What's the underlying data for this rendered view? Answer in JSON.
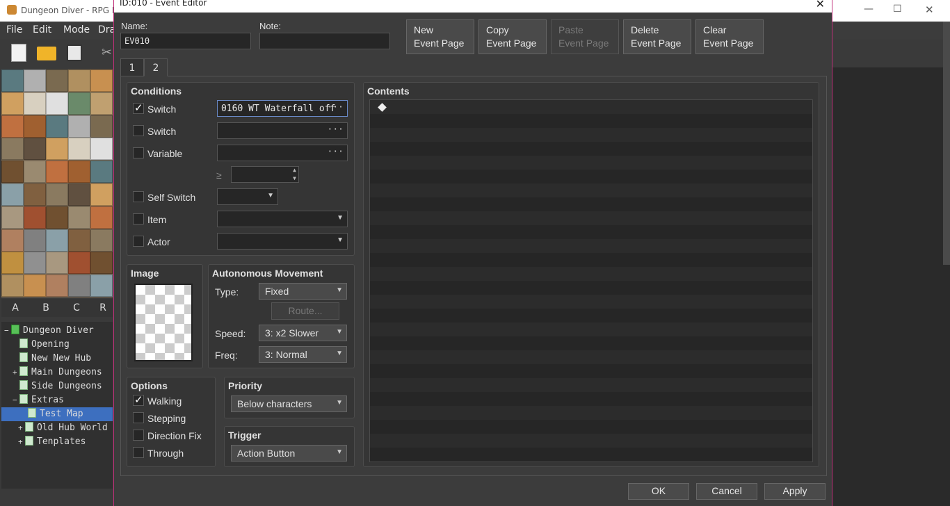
{
  "app": {
    "title": "Dungeon Diver - RPG Ma"
  },
  "menu": [
    "File",
    "Edit",
    "Mode",
    "Dra"
  ],
  "tileset_tabs": [
    "A",
    "B",
    "C",
    "R"
  ],
  "map_tree": [
    {
      "label": "Dungeon Diver",
      "expander": "−"
    },
    {
      "label": "Opening",
      "expander": ""
    },
    {
      "label": "New New Hub",
      "expander": ""
    },
    {
      "label": "Main Dungeons",
      "expander": "+"
    },
    {
      "label": "Side Dungeons",
      "expander": ""
    },
    {
      "label": "Extras",
      "expander": "−"
    },
    {
      "label": "Test Map",
      "expander": ""
    },
    {
      "label": "Old Hub World",
      "expander": "+"
    },
    {
      "label": "Tenplates",
      "expander": "+"
    }
  ],
  "dialog": {
    "title": "ID:010 - Event Editor",
    "close": "✕",
    "name_label": "Name:",
    "name_value": "EV010",
    "note_label": "Note:",
    "note_value": "",
    "buttons": {
      "new_page": [
        "New",
        "Event Page"
      ],
      "copy_page": [
        "Copy",
        "Event Page"
      ],
      "paste_page": [
        "Paste",
        "Event Page"
      ],
      "delete_page": [
        "Delete",
        "Event Page"
      ],
      "clear_page": [
        "Clear",
        "Event Page"
      ]
    },
    "page_tabs": [
      "1",
      "2"
    ],
    "conditions": {
      "title": "Conditions",
      "switch1": {
        "label": "Switch",
        "checked": true,
        "value": "0160 WT Waterfall off"
      },
      "switch2": {
        "label": "Switch",
        "checked": false,
        "value": ""
      },
      "variable": {
        "label": "Variable",
        "checked": false,
        "value": ""
      },
      "gte": "≥",
      "self_switch": {
        "label": "Self Switch",
        "checked": false
      },
      "item": {
        "label": "Item",
        "checked": false
      },
      "actor": {
        "label": "Actor",
        "checked": false
      },
      "dots": "···"
    },
    "image": {
      "title": "Image"
    },
    "movement": {
      "title": "Autonomous Movement",
      "type_label": "Type:",
      "type_value": "Fixed",
      "route": "Route...",
      "speed_label": "Speed:",
      "speed_value": "3: x2 Slower",
      "freq_label": "Freq:",
      "freq_value": "3: Normal"
    },
    "options": {
      "title": "Options",
      "walking": {
        "label": "Walking",
        "checked": true
      },
      "stepping": {
        "label": "Stepping",
        "checked": false
      },
      "direction_fix": {
        "label": "Direction Fix",
        "checked": false
      },
      "through": {
        "label": "Through",
        "checked": false
      }
    },
    "priority": {
      "title": "Priority",
      "value": "Below characters"
    },
    "trigger": {
      "title": "Trigger",
      "value": "Action Button"
    },
    "contents": {
      "title": "Contents"
    },
    "footer": {
      "ok": "OK",
      "cancel": "Cancel",
      "apply": "Apply"
    }
  },
  "window_controls": {
    "minimize": "—",
    "maximize": "☐",
    "close": "✕"
  }
}
